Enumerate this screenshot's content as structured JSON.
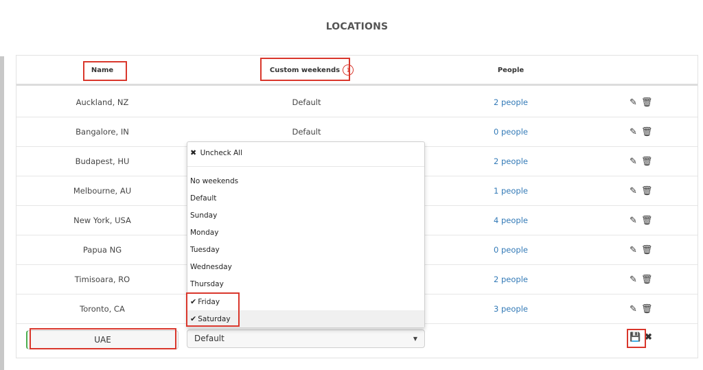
{
  "page_title": "LOCATIONS",
  "table": {
    "columns": {
      "name": "Name",
      "custom_weekends": "Custom weekends",
      "people": "People"
    },
    "info_icon_glyph": "i",
    "rows": [
      {
        "name": "Auckland, NZ",
        "weekends": "Default",
        "people": "2 people"
      },
      {
        "name": "Bangalore, IN",
        "weekends": "Default",
        "people": "0 people"
      },
      {
        "name": "Budapest, HU",
        "weekends": "",
        "people": "2 people"
      },
      {
        "name": "Melbourne, AU",
        "weekends": "",
        "people": "1 people"
      },
      {
        "name": "New York, USA",
        "weekends": "",
        "people": "4 people"
      },
      {
        "name": "Papua NG",
        "weekends": "",
        "people": "0 people"
      },
      {
        "name": "Timisoara, RO",
        "weekends": "",
        "people": "2 people"
      },
      {
        "name": "Toronto, CA",
        "weekends": "",
        "people": "3 people"
      }
    ],
    "row_actions": {
      "edit_icon": "pencil-icon",
      "delete_icon": "trash-icon"
    }
  },
  "edit_row": {
    "name_value": "UAE",
    "weekends_select_value": "Default",
    "save_icon": "floppy-disk-icon",
    "cancel_icon": "close-icon"
  },
  "weekends_dropdown": {
    "uncheck_all": "Uncheck All",
    "options": [
      {
        "label": "No weekends",
        "checked": false
      },
      {
        "label": "Default",
        "checked": false
      },
      {
        "label": "Sunday",
        "checked": false
      },
      {
        "label": "Monday",
        "checked": false
      },
      {
        "label": "Tuesday",
        "checked": false
      },
      {
        "label": "Wednesday",
        "checked": false
      },
      {
        "label": "Thursday",
        "checked": false
      },
      {
        "label": "Friday",
        "checked": true
      },
      {
        "label": "Saturday",
        "checked": true
      }
    ]
  },
  "colors": {
    "link": "#337ab7",
    "highlight_box": "#d9362b",
    "active_field_border": "#4caf50"
  }
}
